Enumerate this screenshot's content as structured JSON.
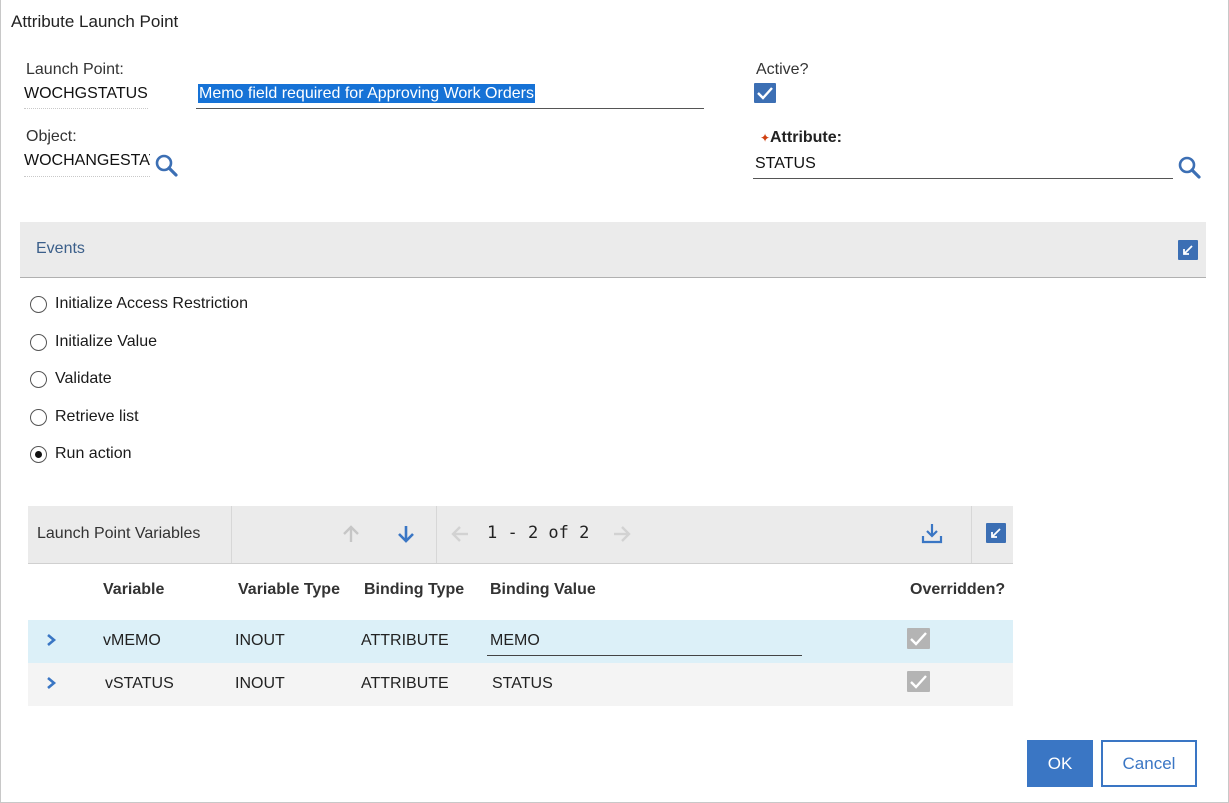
{
  "dialog": {
    "title": "Attribute Launch Point"
  },
  "form": {
    "launch_point_label": "Launch Point:",
    "launch_point_value": "WOCHGSTATUS",
    "description_value": "Memo field required for Approving Work Orders",
    "active_label": "Active?",
    "active_checked": true,
    "object_label": "Object:",
    "object_value": "WOCHANGESTATUS",
    "attribute_label": "Attribute:",
    "attribute_required": true,
    "attribute_value": "STATUS"
  },
  "events": {
    "title": "Events",
    "options": [
      {
        "label": "Initialize Access Restriction",
        "selected": false
      },
      {
        "label": "Initialize Value",
        "selected": false
      },
      {
        "label": "Validate",
        "selected": false
      },
      {
        "label": "Retrieve list",
        "selected": false
      },
      {
        "label": "Run action",
        "selected": true
      }
    ]
  },
  "variables_table": {
    "title": "Launch Point Variables",
    "pager": "1 - 2 of 2",
    "columns": [
      "Variable",
      "Variable Type",
      "Binding Type",
      "Binding Value",
      "Overridden?"
    ],
    "rows": [
      {
        "variable": "vMEMO",
        "variable_type": "INOUT",
        "binding_type": "ATTRIBUTE",
        "binding_value": "MEMO",
        "overridden": true
      },
      {
        "variable": "vSTATUS",
        "variable_type": "INOUT",
        "binding_type": "ATTRIBUTE",
        "binding_value": "STATUS",
        "overridden": true
      }
    ]
  },
  "buttons": {
    "ok": "OK",
    "cancel": "Cancel"
  },
  "colors": {
    "accent": "#3a76c4",
    "selection": "#1672d6",
    "selected_row": "#dcf0f8",
    "required": "#d04010"
  }
}
